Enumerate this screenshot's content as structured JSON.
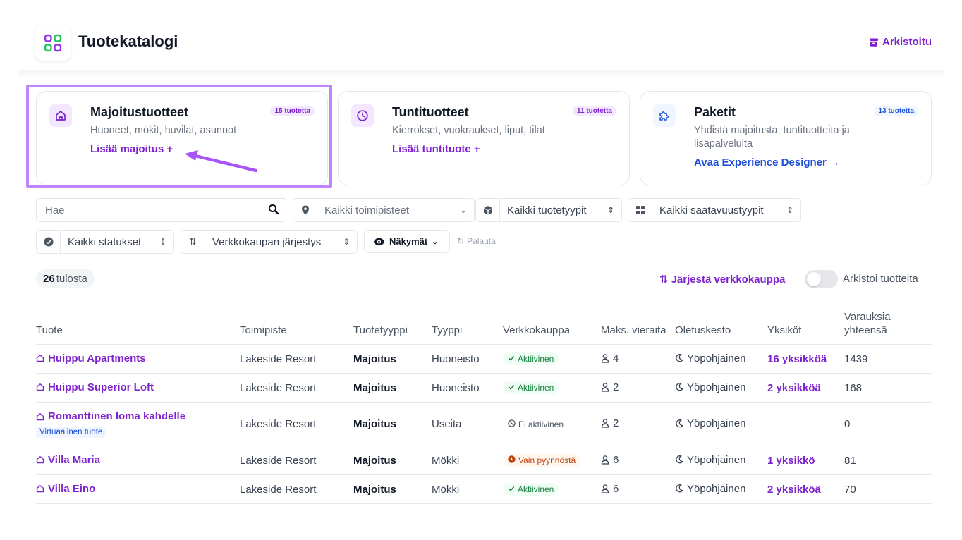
{
  "header": {
    "title": "Tuotekatalogi",
    "archived_label": "Arkistoitu",
    "accent": "#7e22ce"
  },
  "cards": [
    {
      "title": "Majoitustuotteet",
      "badge": "15 tuotetta",
      "desc": "Huoneet, mökit, huvilat, asunnot",
      "link": "Lisää majoitus +",
      "icon": "home-icon",
      "color": "#7e22ce"
    },
    {
      "title": "Tuntituotteet",
      "badge": "11 tuotetta",
      "desc": "Kierrokset, vuokraukset, liput, tilat",
      "link": "Lisää tuntituote +",
      "icon": "clock-icon",
      "color": "#7e22ce"
    },
    {
      "title": "Paketit",
      "badge": "13 tuotetta",
      "desc": "Yhdistä majoitusta, tuntituotteita ja lisäpalveluita",
      "link": "Avaa Experience Designer →",
      "icon": "puzzle-icon",
      "color": "#1d4ed8"
    }
  ],
  "filters": {
    "search_placeholder": "Hae",
    "locations": "Kaikki toimipisteet",
    "product_types": "Kaikki tuotetyypit",
    "availability_types": "Kaikki saatavuustyypit",
    "statuses": "Kaikki statukset",
    "sort": "Verkkokaupan järjestys",
    "views": "Näkymät",
    "reset": "Palauta"
  },
  "results": {
    "count": "26",
    "label": "tulosta",
    "sort_webshop": "Järjestä verkkokauppa",
    "archive_toggle": "Arkistoi tuotteita"
  },
  "table": {
    "headers": {
      "product": "Tuote",
      "location": "Toimipiste",
      "product_type": "Tuotetyyppi",
      "type": "Tyyppi",
      "webshop": "Verkkokauppa",
      "max_guests": "Maks. vieraita",
      "default_duration": "Oletuskesto",
      "units": "Yksiköt",
      "bookings_total": "Varauksia yhteensä"
    },
    "rows": [
      {
        "name": "Huippu Apartments",
        "badge": "",
        "location": "Lakeside Resort",
        "product_type": "Majoitus",
        "type": "Huoneisto",
        "status": "Aktiivinen",
        "status_kind": "active",
        "guests": "4",
        "duration": "Yöpohjainen",
        "units": "16 yksikköä",
        "bookings": "1439"
      },
      {
        "name": "Huippu Superior Loft",
        "badge": "",
        "location": "Lakeside Resort",
        "product_type": "Majoitus",
        "type": "Huoneisto",
        "status": "Aktiivinen",
        "status_kind": "active",
        "guests": "2",
        "duration": "Yöpohjainen",
        "units": "2 yksikköä",
        "bookings": "168"
      },
      {
        "name": "Romanttinen loma kahdelle",
        "badge": "Virtuaalinen tuote",
        "location": "Lakeside Resort",
        "product_type": "Majoitus",
        "type": "Useita",
        "status": "Ei aktiivinen",
        "status_kind": "inactive",
        "guests": "2",
        "duration": "Yöpohjainen",
        "units": "",
        "bookings": "0"
      },
      {
        "name": "Villa Maria",
        "badge": "",
        "location": "Lakeside Resort",
        "product_type": "Majoitus",
        "type": "Mökki",
        "status": "Vain pyynnöstä",
        "status_kind": "request",
        "guests": "6",
        "duration": "Yöpohjainen",
        "units": "1 yksikkö",
        "bookings": "81"
      },
      {
        "name": "Villa Eino",
        "badge": "",
        "location": "Lakeside Resort",
        "product_type": "Majoitus",
        "type": "Mökki",
        "status": "Aktiivinen",
        "status_kind": "active",
        "guests": "6",
        "duration": "Yöpohjainen",
        "units": "2 yksikköä",
        "bookings": "70"
      }
    ]
  }
}
